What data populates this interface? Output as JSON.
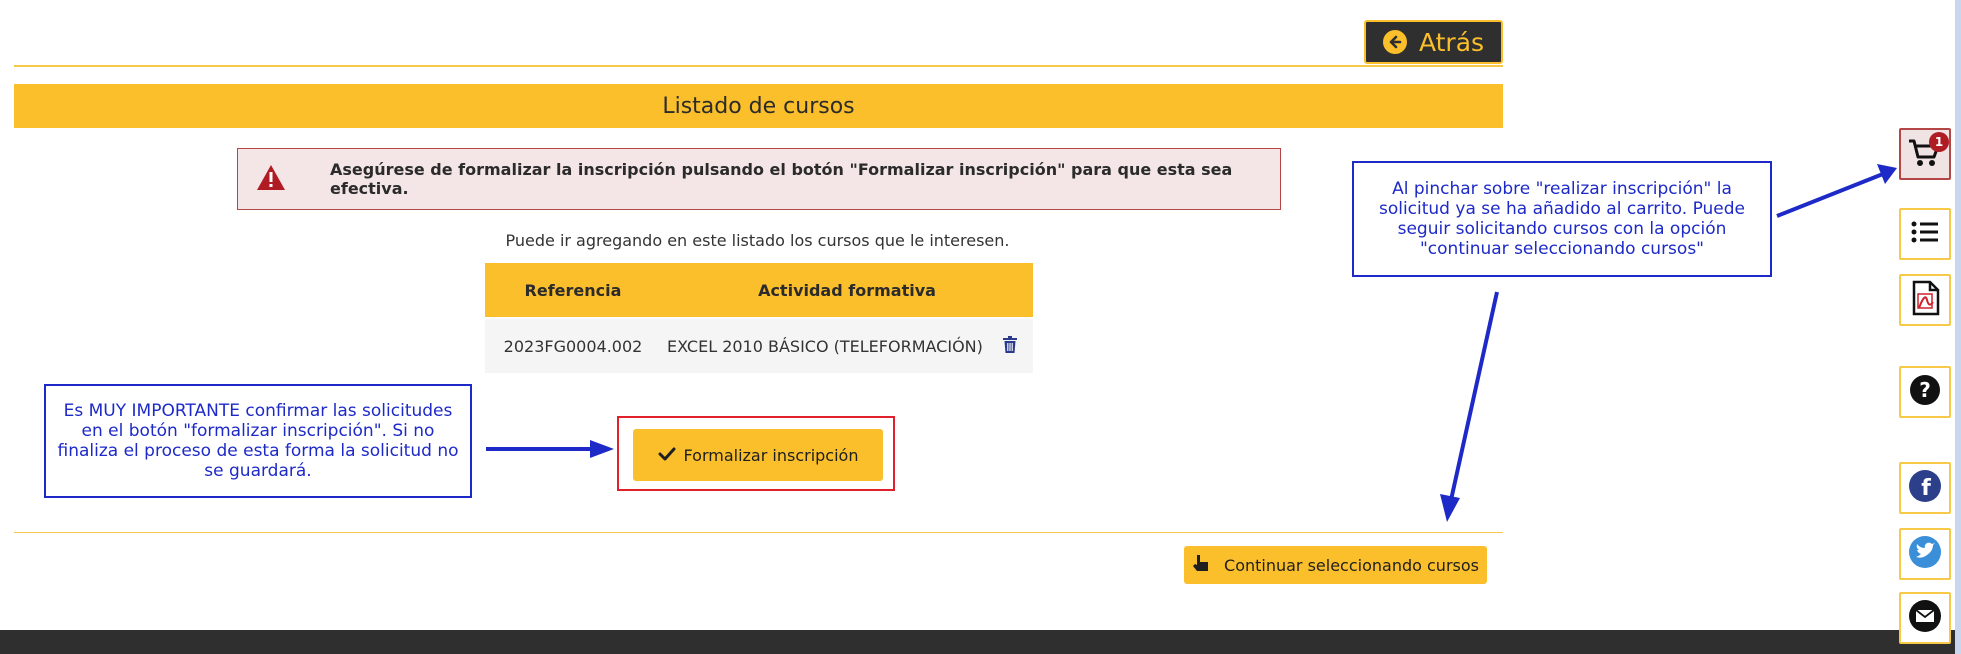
{
  "header": {
    "back_label": "Atrás"
  },
  "page_title": "Listado de cursos",
  "alert": {
    "text": "Asegúrese de formalizar la inscripción pulsando el botón \"Formalizar inscripción\" para que esta sea efectiva.",
    "icon": "warning-triangle-icon",
    "color": "#b01c24"
  },
  "hint": "Puede ir agregando en este listado los cursos que le interesen.",
  "table": {
    "headers": [
      "Referencia",
      "Actividad formativa"
    ],
    "rows": [
      {
        "referencia": "2023FG0004.002",
        "actividad": "EXCEL 2010 BÁSICO (TELEFORMACIÓN)"
      }
    ]
  },
  "formalize_label": "Formalizar inscripción",
  "continue_label": "Continuar seleccionando cursos",
  "callouts": {
    "left": "Es MUY IMPORTANTE confirmar las solicitudes en el botón \"formalizar inscripción\". Si no finaliza el proceso de esta forma la solicitud no se guardará.",
    "right": "Al pinchar sobre \"realizar inscripción\" la solicitud ya se ha añadido al carrito. Puede seguir solicitando cursos con la opción \"continuar seleccionando cursos\""
  },
  "sidebar": {
    "cart_count": "1",
    "icons": [
      "cart-icon",
      "list-icon",
      "pdf-icon",
      "help-icon",
      "facebook-icon",
      "twitter-icon",
      "mail-icon"
    ]
  },
  "colors": {
    "accent": "#fbbf2c",
    "dark": "#2f2f2f",
    "annotation_blue": "#1d2ac7",
    "outline_red": "#e0202a"
  }
}
